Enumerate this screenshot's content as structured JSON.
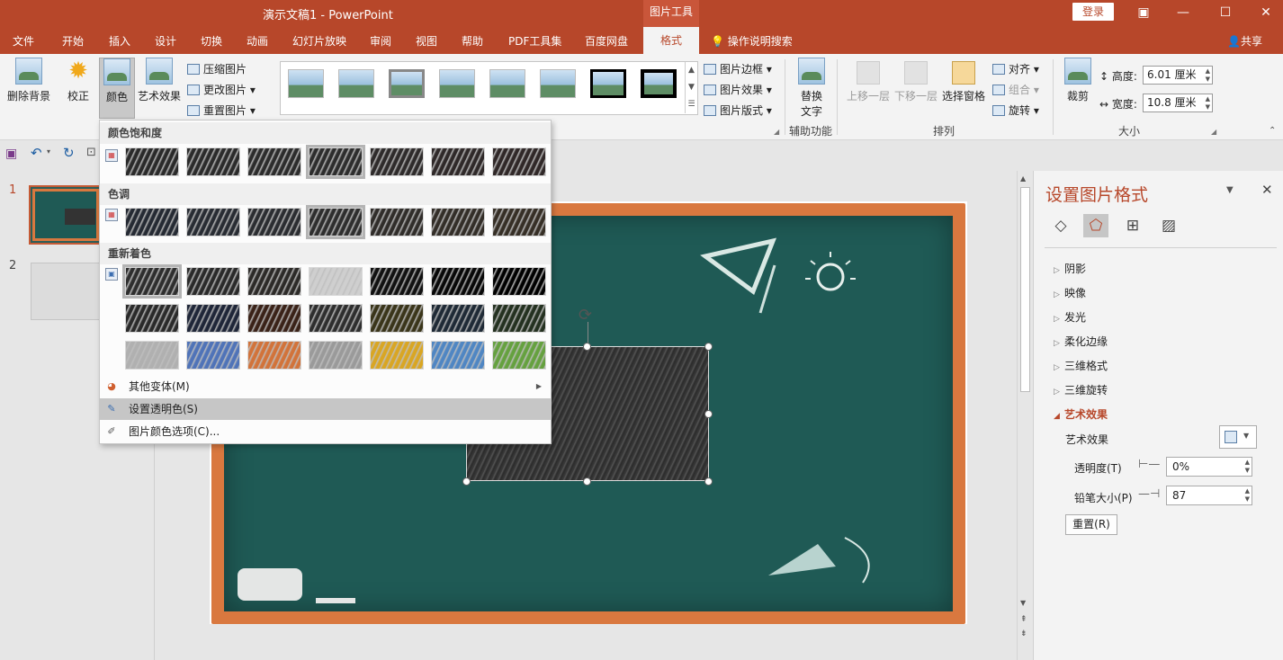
{
  "titlebar": {
    "title": "演示文稿1  -  PowerPoint",
    "context_header": "图片工具",
    "login": "登录",
    "restore_icon": "ribbon-display-icon",
    "minimize": "—",
    "maximize": "☐",
    "close": "✕"
  },
  "tabs": {
    "file": "文件",
    "home": "开始",
    "insert": "插入",
    "design": "设计",
    "transitions": "切换",
    "animations": "动画",
    "slideshow": "幻灯片放映",
    "review": "审阅",
    "view": "视图",
    "help": "帮助",
    "pdf": "PDF工具集",
    "baidu": "百度网盘",
    "format": "格式",
    "tell_me": "操作说明搜索",
    "share": "共享"
  },
  "ribbon": {
    "remove_bg": "删除背景",
    "corrections": "校正",
    "color": "颜色",
    "artistic": "艺术效果",
    "compress": "压缩图片",
    "change": "更改图片",
    "reset": "重置图片",
    "border": "图片边框",
    "effects": "图片效果",
    "layout": "图片版式",
    "alt_text_line1": "替换",
    "alt_text_line2": "文字",
    "accessibility": "辅助功能",
    "bring_forward": "上移一层",
    "send_backward": "下移一层",
    "selection_pane": "选择窗格",
    "align": "对齐",
    "group": "组合",
    "rotate": "旋转",
    "arrange": "排列",
    "crop": "裁剪",
    "height_label": "高度:",
    "height_value": "6.01 厘米",
    "width_label": "宽度:",
    "width_value": "10.8 厘米",
    "size": "大小"
  },
  "thumbnails": {
    "slide1_num": "1",
    "slide2_num": "2"
  },
  "color_menu": {
    "saturation_header": "颜色饱和度",
    "tone_header": "色调",
    "recolor_header": "重新着色",
    "more_variations": "其他变体(M)",
    "set_transparent": "设置透明色(S)",
    "color_options": "图片颜色选项(C)...",
    "saturation_swatches": [
      "#2a2a2a",
      "#2b2b2b",
      "#2c2c2c",
      "#2d2d2d",
      "#2e2b2b",
      "#2f2929",
      "#302828"
    ],
    "tone_swatches": [
      "#252a33",
      "#282c33",
      "#2b2d31",
      "#2e2e2e",
      "#302d2a",
      "#332e28",
      "#362f26"
    ],
    "recolor_row1": [
      "#2e2e2e",
      "#2a2a2a",
      "#2c2a28",
      "#cfcfcf",
      "#111111",
      "#080808",
      "#000000"
    ],
    "recolor_row2": [
      "#2a2a2a",
      "#1f2638",
      "#3a2218",
      "#2e2e2e",
      "#3a351a",
      "#1f2a36",
      "#243120"
    ],
    "recolor_row3": [
      "#b0b0b0",
      "#4f73b8",
      "#d2733a",
      "#9a9a9a",
      "#d9a623",
      "#4f86c3",
      "#65a13f"
    ]
  },
  "format_pane": {
    "title": "设置图片格式",
    "sections": [
      "阴影",
      "映像",
      "发光",
      "柔化边缘",
      "三维格式",
      "三维旋转",
      "艺术效果"
    ],
    "artistic_label": "艺术效果",
    "transparency_label": "透明度(T)",
    "transparency_value": "0%",
    "pencil_label": "铅笔大小(P)",
    "pencil_value": "87",
    "reset_label": "重置(R)"
  },
  "colors": {
    "accent": "#b7472a",
    "board": "#1f5a55",
    "frame": "#d9783f"
  }
}
